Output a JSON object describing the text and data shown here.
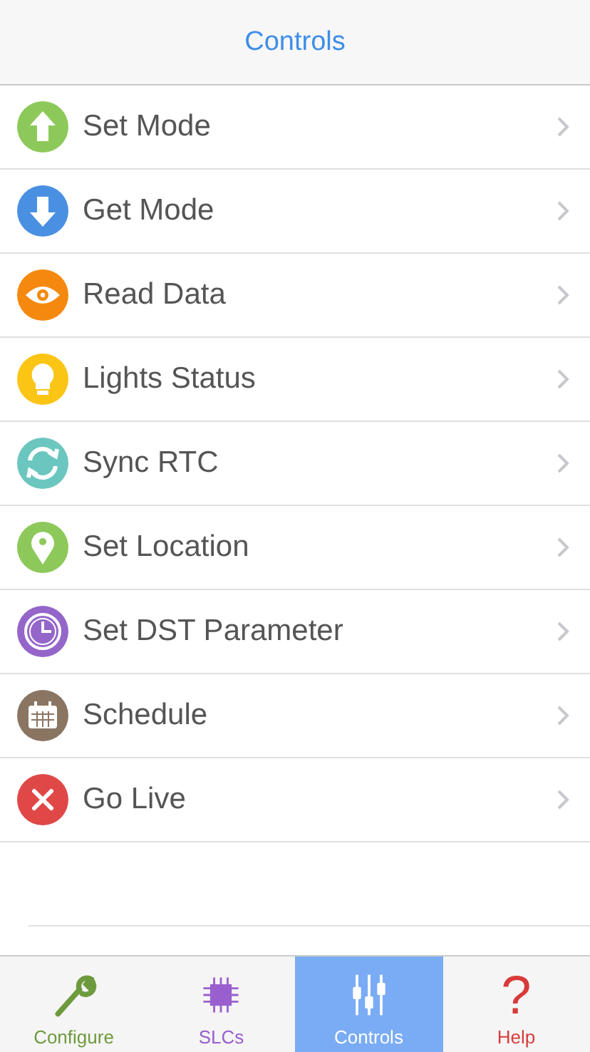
{
  "header": {
    "title": "Controls"
  },
  "items": [
    {
      "label": "Set Mode",
      "kind": "up",
      "color": "#8dc95a"
    },
    {
      "label": "Get Mode",
      "kind": "down",
      "color": "#4a90e2"
    },
    {
      "label": "Read Data",
      "kind": "eye",
      "color": "#f5890f"
    },
    {
      "label": "Lights Status",
      "kind": "bulb",
      "color": "#fbc515"
    },
    {
      "label": "Sync RTC",
      "kind": "sync",
      "color": "#6cc6c0"
    },
    {
      "label": "Set Location",
      "kind": "pin",
      "color": "#8dc95a"
    },
    {
      "label": "Set DST Parameter",
      "kind": "clock",
      "color": "#9466c9"
    },
    {
      "label": "Schedule",
      "kind": "calendar",
      "color": "#8a7563"
    },
    {
      "label": "Go Live",
      "kind": "cross",
      "color": "#e04848"
    }
  ],
  "tabs": [
    {
      "label": "Configure",
      "kind": "wrench",
      "color": "#6e9a3e",
      "selected": false
    },
    {
      "label": "SLCs",
      "kind": "chip",
      "color": "#9a5fcf",
      "selected": false
    },
    {
      "label": "Controls",
      "kind": "sliders",
      "color": "#ffffff",
      "selected": true
    },
    {
      "label": "Help",
      "kind": "help",
      "color": "#d93a3a",
      "selected": false,
      "glyph": "?"
    }
  ]
}
